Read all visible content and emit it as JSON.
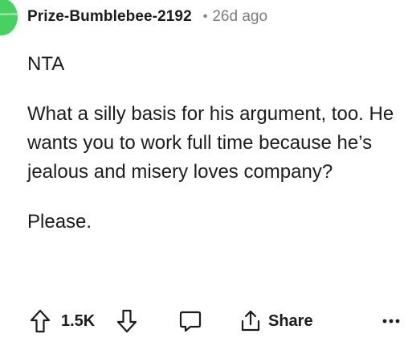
{
  "comment": {
    "author": "Prize-Bumblebee-2192",
    "separator": "•",
    "time_ago": "26d ago",
    "paragraphs": [
      "NTA",
      "What a silly basis for his argument, too. He wants you to work full time because he’s jealous and misery loves company?",
      "Please."
    ]
  },
  "actions": {
    "vote_count": "1.5K",
    "share_label": "Share",
    "icons": {
      "upvote": "arrow-up-icon",
      "downvote": "arrow-down-icon",
      "comment": "speech-bubble-icon",
      "share": "share-icon",
      "more": "ellipsis-icon"
    }
  },
  "colors": {
    "avatar": "#46d160",
    "text": "#1c1c1c",
    "meta": "#7c7c7c"
  }
}
